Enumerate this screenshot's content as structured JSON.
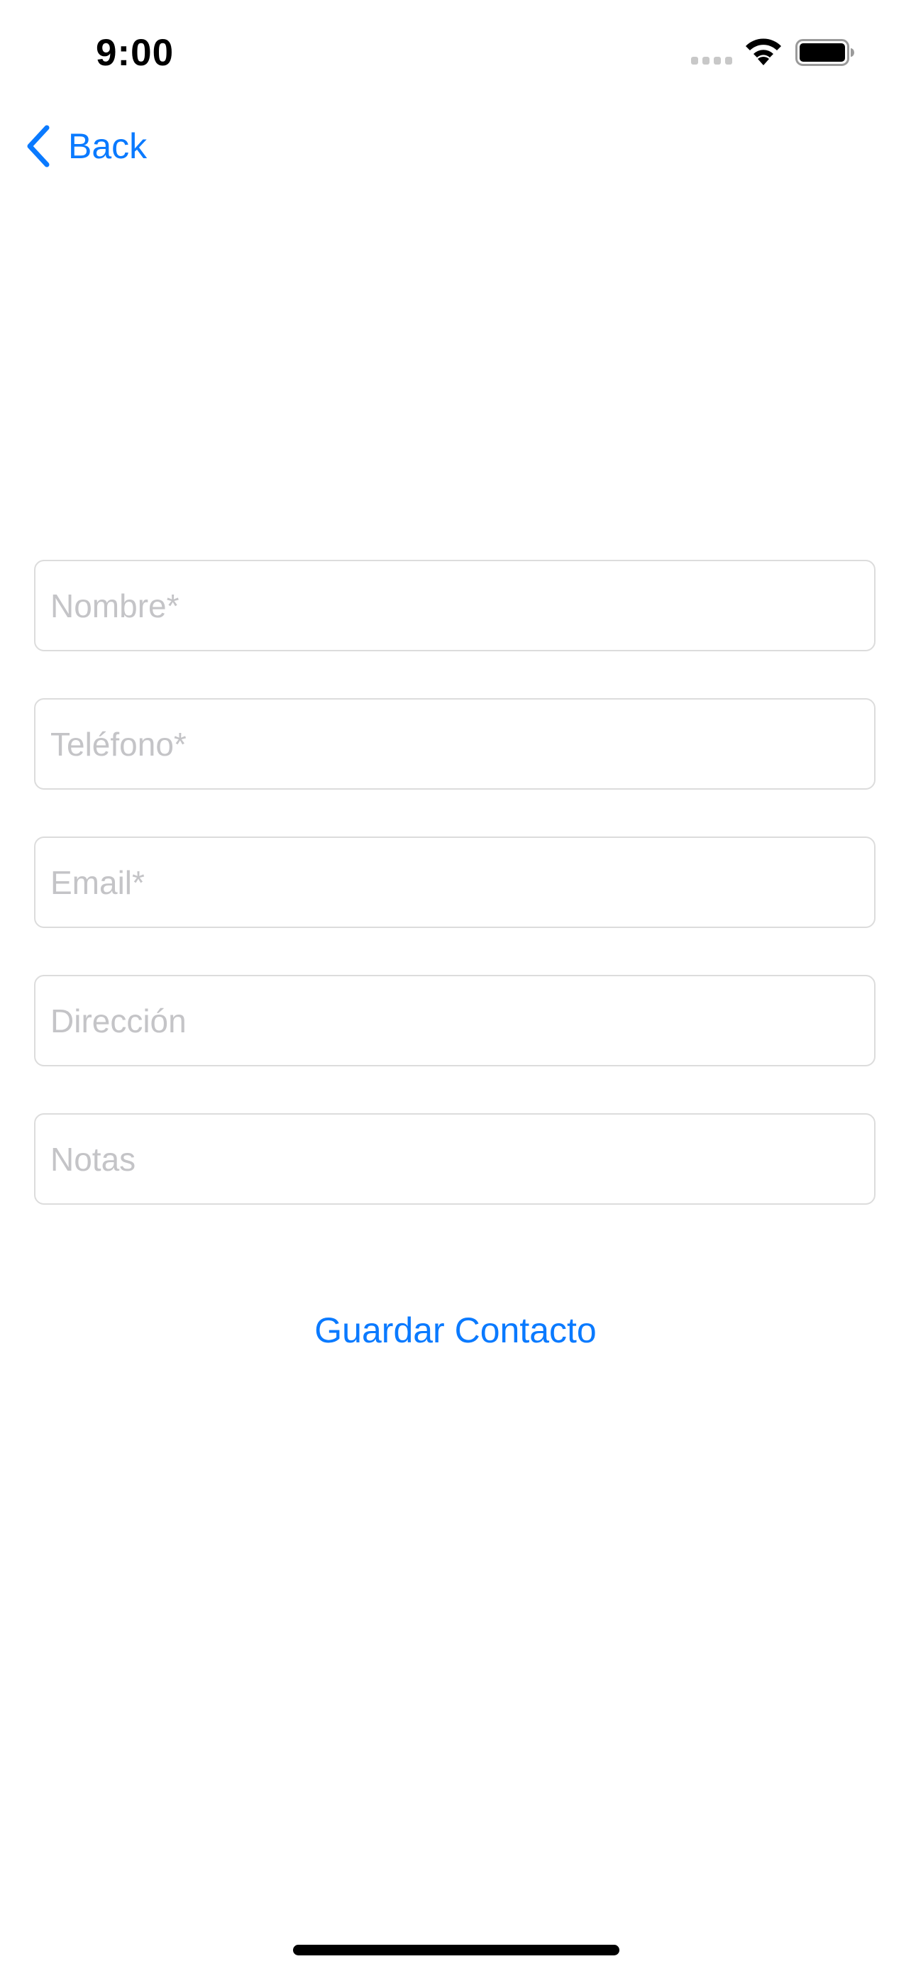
{
  "status_bar": {
    "time": "9:00",
    "signal_icon": "cellular-dots-icon",
    "wifi_icon": "wifi-icon",
    "battery_icon": "battery-icon"
  },
  "nav": {
    "back_label": "Back",
    "back_icon": "chevron-left-icon"
  },
  "form": {
    "fields": [
      {
        "placeholder": "Nombre*",
        "value": ""
      },
      {
        "placeholder": "Teléfono*",
        "value": ""
      },
      {
        "placeholder": "Email*",
        "value": ""
      },
      {
        "placeholder": "Dirección",
        "value": ""
      },
      {
        "placeholder": "Notas",
        "value": ""
      }
    ],
    "save_label": "Guardar Contacto"
  },
  "colors": {
    "accent": "#0a7aff",
    "placeholder": "#c4c4c7",
    "border": "#dcdcdc"
  }
}
